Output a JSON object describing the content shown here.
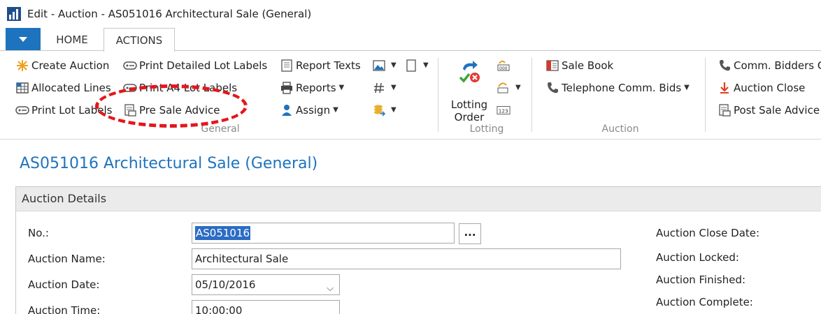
{
  "window": {
    "title": "Edit - Auction - AS051016 Architectural Sale (General)"
  },
  "tabs": {
    "home": "HOME",
    "actions": "ACTIONS"
  },
  "ribbon": {
    "general": {
      "col1": [
        "Create Auction",
        "Allocated Lines",
        "Print Lot Labels"
      ],
      "col2": [
        "Print Detailed Lot Labels",
        "Print A4 Lot Labels",
        "Pre Sale Advice"
      ],
      "col3": [
        "Report Texts",
        "Reports",
        "Assign"
      ],
      "label": "General"
    },
    "lotting": {
      "big_button": [
        "Lotting",
        "Order"
      ],
      "label": "Lotting"
    },
    "auction": {
      "items": [
        "Sale Book",
        "Telephone Comm. Bids"
      ],
      "label": "Auction"
    },
    "right": {
      "items": [
        "Comm. Bidders C",
        "Auction Close",
        "Post Sale Advice"
      ]
    }
  },
  "page": {
    "title": "AS051016 Architectural Sale (General)"
  },
  "auction_details": {
    "header": "Auction Details",
    "no_label": "No.:",
    "no_value": "AS051016",
    "name_label": "Auction Name:",
    "name_value": "Architectural Sale",
    "date_label": "Auction Date:",
    "date_value": "05/10/2016",
    "time_label": "Auction Time:",
    "time_value": "10:00:00",
    "lookup_label": "...",
    "right_labels": [
      "Auction Close Date:",
      "Auction Locked:",
      "Auction Finished:",
      "Auction Complete:"
    ]
  },
  "colors": {
    "accent": "#1e73be",
    "annotation": "#e4161b",
    "selection": "#2b6cc4"
  }
}
